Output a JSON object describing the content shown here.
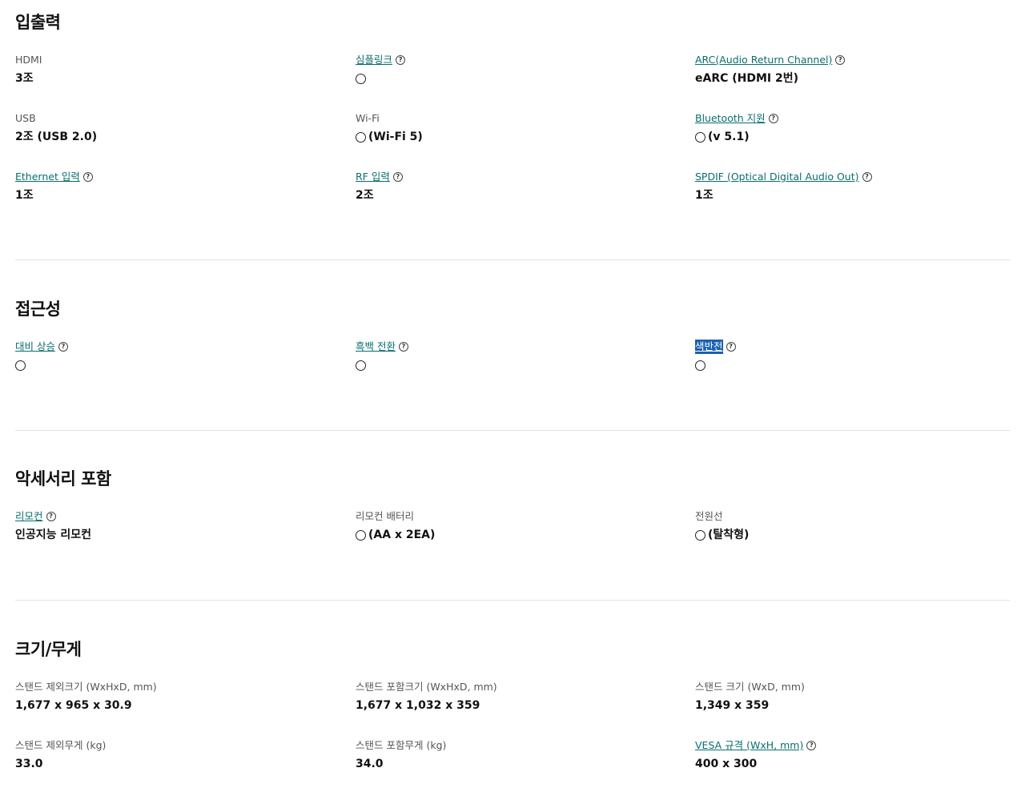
{
  "sections": [
    {
      "title": "입출력",
      "rows": [
        [
          {
            "label": "HDMI",
            "link": false,
            "help": false,
            "value": "3조",
            "circle": false
          },
          {
            "label": "심플링크",
            "link": true,
            "help": true,
            "value": "",
            "circle": true
          },
          {
            "label": "ARC(Audio Return Channel)",
            "link": true,
            "help": true,
            "value": "eARC (HDMI 2번)",
            "circle": false
          }
        ],
        [
          {
            "label": "USB",
            "link": false,
            "help": false,
            "value": "2조 (USB 2.0)",
            "circle": false
          },
          {
            "label": "Wi-Fi",
            "link": false,
            "help": false,
            "value": "(Wi-Fi 5)",
            "circle": true
          },
          {
            "label": "Bluetooth 지원",
            "link": true,
            "help": true,
            "value": "(v 5.1)",
            "circle": true
          }
        ],
        [
          {
            "label": "Ethernet 입력",
            "link": true,
            "help": true,
            "value": "1조",
            "circle": false
          },
          {
            "label": "RF 입력",
            "link": true,
            "help": true,
            "value": "2조",
            "circle": false
          },
          {
            "label": "SPDIF (Optical Digital Audio Out)",
            "link": true,
            "help": true,
            "value": "1조",
            "circle": false
          }
        ]
      ]
    },
    {
      "title": "접근성",
      "rows": [
        [
          {
            "label": "대비 상승",
            "link": true,
            "help": true,
            "value": "",
            "circle": true
          },
          {
            "label": "흑백 전환",
            "link": true,
            "help": true,
            "value": "",
            "circle": true
          },
          {
            "label": "색반전",
            "link": true,
            "help": true,
            "value": "",
            "circle": true,
            "selected": true
          }
        ]
      ]
    },
    {
      "title": "악세서리 포함",
      "rows": [
        [
          {
            "label": "리모컨",
            "link": true,
            "help": true,
            "value": "인공지능 리모컨",
            "circle": false
          },
          {
            "label": "리모컨 배터리",
            "link": false,
            "help": false,
            "value": "(AA x 2EA)",
            "circle": true
          },
          {
            "label": "전원선",
            "link": false,
            "help": false,
            "value": "(탈착형)",
            "circle": true
          }
        ]
      ]
    },
    {
      "title": "크기/무게",
      "rows": [
        [
          {
            "label": "스탠드 제외크기 (WxHxD, mm)",
            "link": false,
            "help": false,
            "value": "1,677 x 965 x 30.9",
            "circle": false
          },
          {
            "label": "스탠드 포함크기 (WxHxD, mm)",
            "link": false,
            "help": false,
            "value": "1,677 x 1,032 x 359",
            "circle": false
          },
          {
            "label": "스탠드 크기 (WxD, mm)",
            "link": false,
            "help": false,
            "value": "1,349 x 359",
            "circle": false
          }
        ],
        [
          {
            "label": "스탠드 제외무게 (kg)",
            "link": false,
            "help": false,
            "value": "33.0",
            "circle": false
          },
          {
            "label": "스탠드 포함무게 (kg)",
            "link": false,
            "help": false,
            "value": "34.0",
            "circle": false
          },
          {
            "label": "VESA 규격 (WxH, mm)",
            "link": true,
            "help": true,
            "value": "400 x 300",
            "circle": false
          }
        ]
      ]
    }
  ],
  "help_glyph": "?"
}
